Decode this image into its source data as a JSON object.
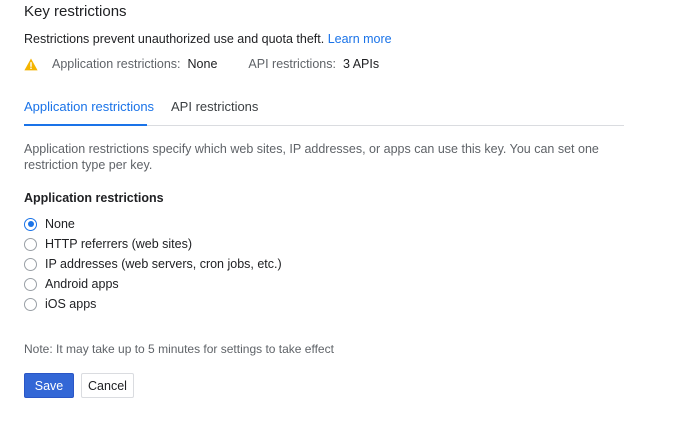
{
  "section": {
    "title": "Key restrictions",
    "description": "Restrictions prevent unauthorized use and quota theft.",
    "learn_more": "Learn more"
  },
  "summary": {
    "icon": "warning-icon",
    "icon_color": "#f4b400",
    "app_label": "Application restrictions:",
    "app_value": "None",
    "api_label": "API restrictions:",
    "api_value": "3 APIs"
  },
  "tabs": [
    {
      "label": "Application restrictions",
      "active": true
    },
    {
      "label": "API restrictions",
      "active": false
    }
  ],
  "app_tab": {
    "explanation": "Application restrictions specify which web sites, IP addresses, or apps can use this key. You can set one restriction type per key.",
    "heading": "Application restrictions",
    "options": [
      {
        "label": "None",
        "selected": true
      },
      {
        "label": "HTTP referrers (web sites)",
        "selected": false
      },
      {
        "label": "IP addresses (web servers, cron jobs, etc.)",
        "selected": false
      },
      {
        "label": "Android apps",
        "selected": false
      },
      {
        "label": "iOS apps",
        "selected": false
      }
    ]
  },
  "note": "Note: It may take up to 5 minutes for settings to take effect",
  "actions": {
    "save": "Save",
    "cancel": "Cancel"
  },
  "colors": {
    "accent": "#1a73e8",
    "primary_button": "#3367d6"
  }
}
